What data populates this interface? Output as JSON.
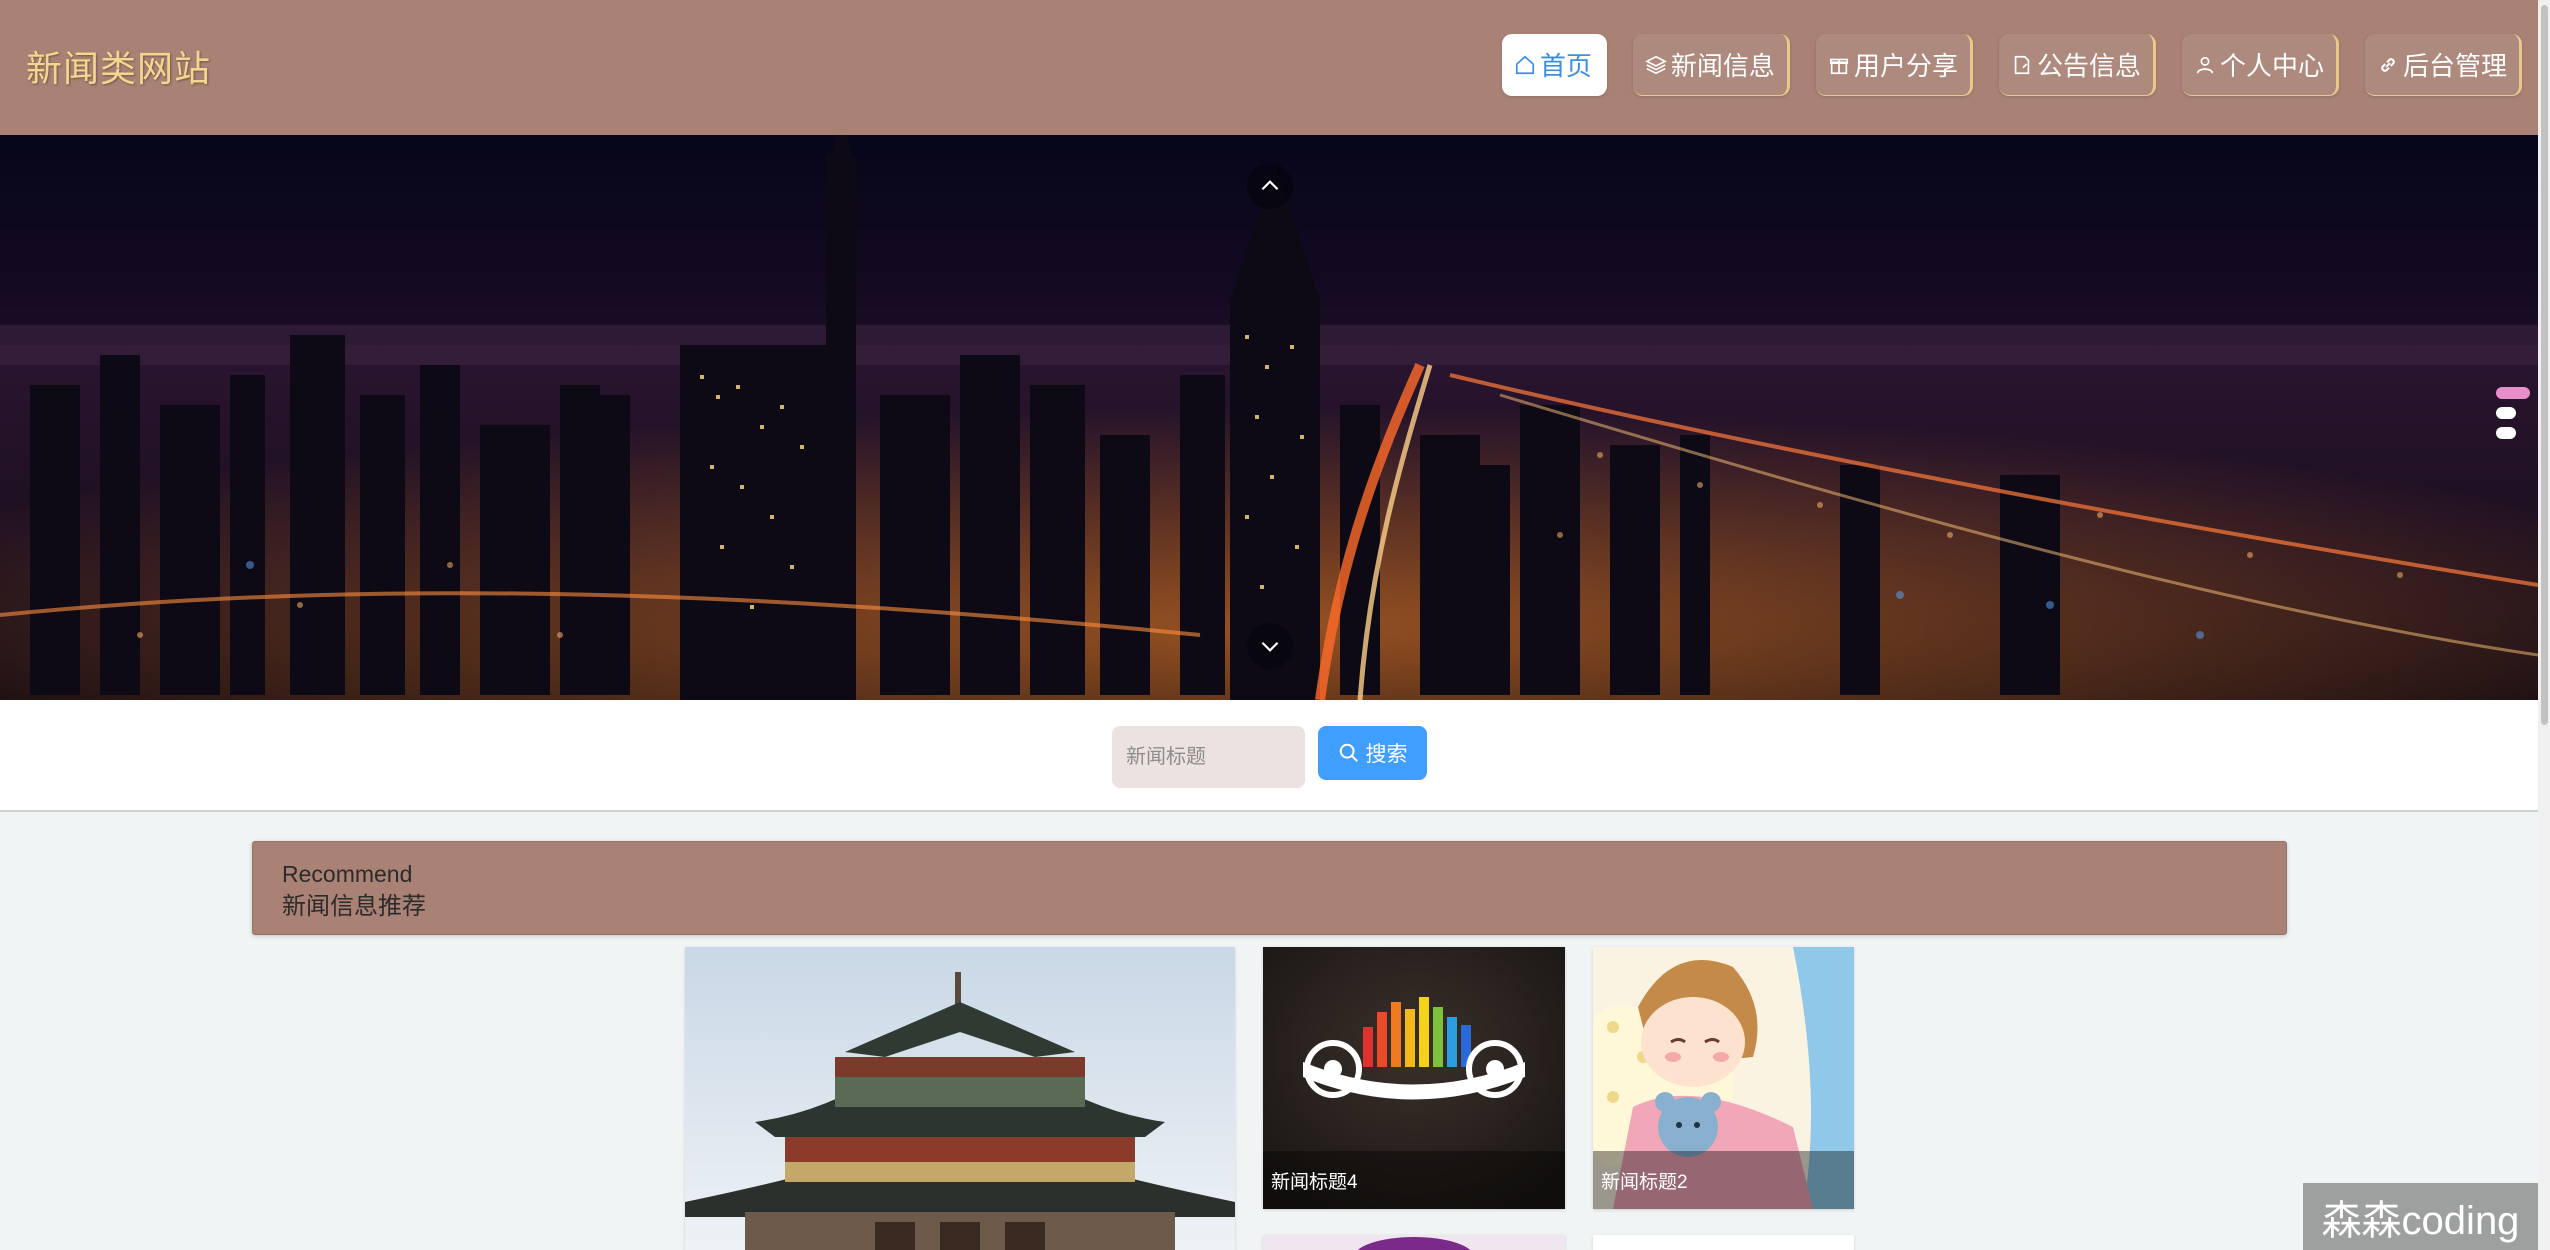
{
  "header": {
    "site_title": "新闻类网站"
  },
  "nav": {
    "items": [
      {
        "label": "首页",
        "icon": "home-icon",
        "active": true
      },
      {
        "label": "新闻信息",
        "icon": "layers-icon"
      },
      {
        "label": "用户分享",
        "icon": "gift-icon"
      },
      {
        "label": "公告信息",
        "icon": "document-icon"
      },
      {
        "label": "个人中心",
        "icon": "user-icon"
      },
      {
        "label": "后台管理",
        "icon": "link-icon"
      }
    ]
  },
  "banner": {
    "active_slide": 1,
    "slide_count": 3
  },
  "search": {
    "placeholder": "新闻标题",
    "button_label": "搜索"
  },
  "recommend": {
    "title_en": "Recommend",
    "title_cn": "新闻信息推荐"
  },
  "cards": [
    {
      "caption": "",
      "image": "pagoda-building"
    },
    {
      "caption": "新闻标题4",
      "image": "music-equalizer-speakers"
    },
    {
      "caption": "新闻标题2",
      "image": "cartoon-girl-sleeping"
    }
  ],
  "watermark": {
    "text": "森森coding"
  },
  "colors": {
    "header_bg": "#a98275",
    "title_gold": "#f6d58e",
    "active_nav_text": "#3c8fe0",
    "search_button": "#409eff",
    "active_dot": "#e78fca"
  }
}
